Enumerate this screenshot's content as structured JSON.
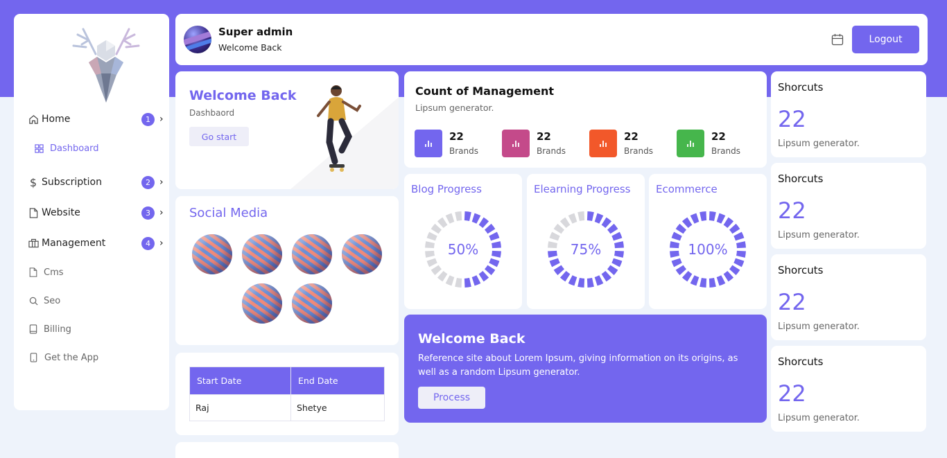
{
  "colors": {
    "accent": "#7366ee",
    "pink": "#c44a8a",
    "orange": "#f2582a",
    "green": "#46b64c",
    "ring_empty": "#d8d8dc"
  },
  "sidebar": {
    "items": [
      {
        "label": "Home",
        "icon": "home-icon",
        "badge": "1",
        "chevron": "›"
      },
      {
        "label": "Dashboard",
        "icon": "grid-icon"
      },
      {
        "label": "Subscription",
        "icon": "dollar-icon",
        "badge": "2",
        "chevron": "›"
      },
      {
        "label": "Website",
        "icon": "file-icon",
        "badge": "3",
        "chevron": "›"
      },
      {
        "label": "Management",
        "icon": "briefcase-icon",
        "badge": "4",
        "chevron": "›"
      },
      {
        "label": "Cms",
        "icon": "file-icon"
      },
      {
        "label": "Seo",
        "icon": "search-icon"
      },
      {
        "label": "Billing",
        "icon": "book-icon"
      },
      {
        "label": "Get the App",
        "icon": "phone-icon"
      }
    ]
  },
  "header": {
    "name": "Super admin",
    "subtitle": "Welcome Back",
    "logout_label": "Logout"
  },
  "welcome_card": {
    "title": "Welcome Back",
    "subtitle": "Dashbaord",
    "button_label": "Go start"
  },
  "social": {
    "title": "Social Media"
  },
  "table": {
    "headers": [
      "Start Date",
      "End Date"
    ],
    "rows": [
      [
        "Raj",
        "Shetye"
      ]
    ]
  },
  "management": {
    "title": "Count of Management",
    "subtitle": "Lipsum generator.",
    "stats": [
      {
        "value": "22",
        "label": "Brands",
        "color": "#7366ee"
      },
      {
        "value": "22",
        "label": "Brands",
        "color": "#c44a8a"
      },
      {
        "value": "22",
        "label": "Brands",
        "color": "#f2582a"
      },
      {
        "value": "22",
        "label": "Brands",
        "color": "#46b64c"
      }
    ]
  },
  "progress": [
    {
      "title": "Blog Progress",
      "value_label": "50%",
      "fraction": 0.5
    },
    {
      "title": "Elearning Progress",
      "value_label": "75%",
      "fraction": 0.75
    },
    {
      "title": "Ecommerce",
      "value_label": "100%",
      "fraction": 1.0
    }
  ],
  "banner": {
    "title": "Welcome Back",
    "text": "Reference site about Lorem Ipsum, giving information on its origins, as well as a random Lipsum generator.",
    "button_label": "Process"
  },
  "shortcuts": [
    {
      "title": "Shorcuts",
      "value": "22",
      "subtitle": "Lipsum generator."
    },
    {
      "title": "Shorcuts",
      "value": "22",
      "subtitle": "Lipsum generator."
    },
    {
      "title": "Shorcuts",
      "value": "22",
      "subtitle": "Lipsum generator."
    },
    {
      "title": "Shorcuts",
      "value": "22",
      "subtitle": "Lipsum generator."
    }
  ]
}
